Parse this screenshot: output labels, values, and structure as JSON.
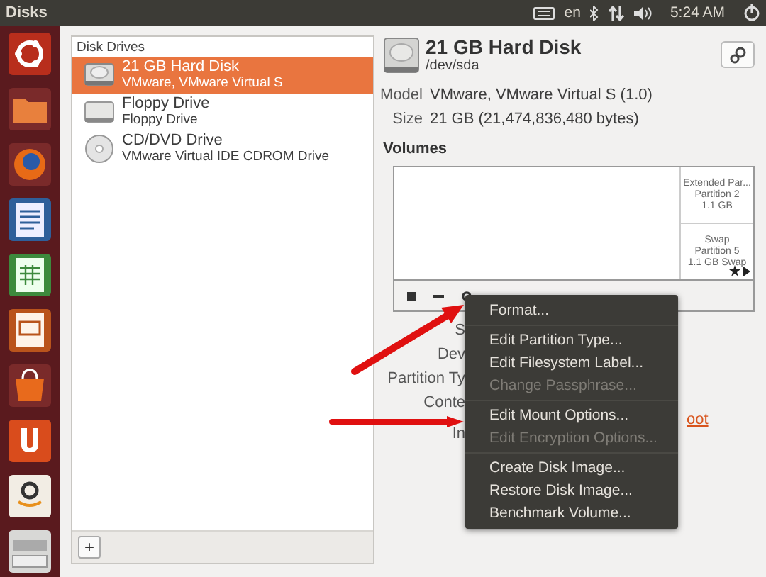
{
  "top_bar": {
    "app_title": "Disks",
    "keyboard_layout": "en",
    "clock": "5:24 AM"
  },
  "launcher": {
    "items": [
      {
        "kind": "ubuntu"
      },
      {
        "kind": "folder"
      },
      {
        "kind": "browser"
      },
      {
        "kind": "writer"
      },
      {
        "kind": "calc"
      },
      {
        "kind": "impress"
      },
      {
        "kind": "shop"
      },
      {
        "kind": "one"
      },
      {
        "kind": "amazon"
      },
      {
        "kind": "stack"
      }
    ]
  },
  "drives_panel": {
    "header": "Disk Drives",
    "drives": [
      {
        "kind": "hdd",
        "name": "21 GB Hard Disk",
        "detail": "VMware, VMware Virtual S",
        "selected": true
      },
      {
        "kind": "floppy",
        "name": "Floppy Drive",
        "detail": "Floppy Drive",
        "selected": false
      },
      {
        "kind": "optical",
        "name": "CD/DVD Drive",
        "detail": "VMware Virtual IDE CDROM Drive",
        "selected": false
      }
    ],
    "add_button": "+"
  },
  "disk": {
    "title": "21 GB Hard Disk",
    "device": "/dev/sda",
    "fields": [
      {
        "label": "Model",
        "value": "VMware, VMware Virtual S (1.0)"
      },
      {
        "label": "Size",
        "value": "21 GB (21,474,836,480 bytes)"
      }
    ]
  },
  "volumes": {
    "heading": "Volumes",
    "partitions": [
      {
        "lines": [
          "Extended Par...",
          "Partition 2",
          "1.1 GB"
        ]
      },
      {
        "lines": [
          "Swap",
          "Partition 5",
          "1.1 GB Swap"
        ]
      }
    ],
    "detail_labels": [
      "S",
      "Dev",
      "Partition Ty",
      "Conte",
      "In"
    ],
    "link": "oot"
  },
  "context_menu": {
    "items": [
      {
        "label": "Format...",
        "disabled": false,
        "separator_before": false
      },
      {
        "label": "Edit Partition Type...",
        "disabled": false,
        "separator_before": true
      },
      {
        "label": "Edit Filesystem Label...",
        "disabled": false,
        "separator_before": false
      },
      {
        "label": "Change Passphrase...",
        "disabled": true,
        "separator_before": false
      },
      {
        "label": "Edit Mount Options...",
        "disabled": false,
        "separator_before": true
      },
      {
        "label": "Edit Encryption Options...",
        "disabled": true,
        "separator_before": false
      },
      {
        "label": "Create Disk Image...",
        "disabled": false,
        "separator_before": true
      },
      {
        "label": "Restore Disk Image...",
        "disabled": false,
        "separator_before": false
      },
      {
        "label": "Benchmark Volume...",
        "disabled": false,
        "separator_before": false
      }
    ]
  }
}
